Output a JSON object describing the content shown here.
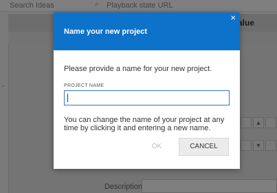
{
  "background": {
    "search_placeholder": "Search Ideas",
    "search_icon": "search-icon",
    "playback_placeholder": "Playback state URL",
    "column_header": "alue",
    "side_marker": "-",
    "description_label": "Description"
  },
  "dialog": {
    "title": "Name your new project",
    "close_icon": "×",
    "prompt": "Please provide a name for your new project.",
    "field_label": "PROJECT NAME",
    "field_value": "",
    "hint": "You can change the name of your project at any time by clicking it and entering a new name.",
    "ok_label": "OK",
    "cancel_label": "CANCEL"
  },
  "colors": {
    "header_blue": "#0d72c9",
    "input_border": "#2e78c9",
    "disabled_text": "#bdbdbd"
  }
}
